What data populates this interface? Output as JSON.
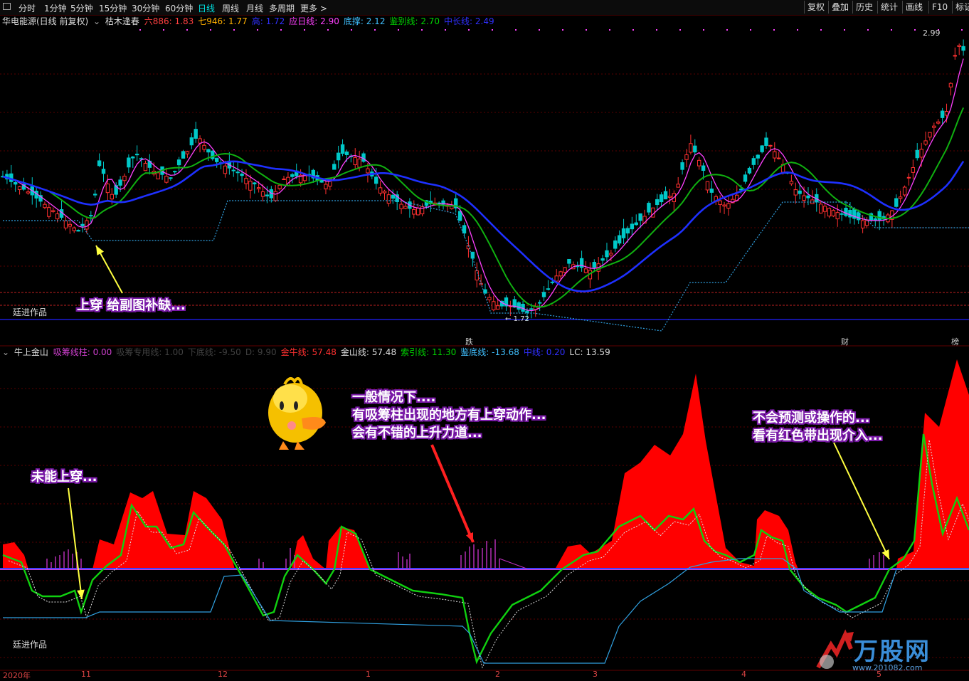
{
  "toolbar": {
    "left_items": [
      "分时",
      "1分钟",
      "5分钟",
      "15分钟",
      "30分钟",
      "60分钟",
      "日线",
      "周线",
      "月线",
      "多周期",
      "更多 >"
    ],
    "active_item": "日线",
    "right_items": [
      "复权",
      "叠加",
      "历史",
      "统计",
      "画线",
      "F10",
      "标记"
    ]
  },
  "main_header": {
    "stock": "华电能源(日线 前复权)",
    "indicator": "枯木逢春",
    "values": [
      {
        "label": "六886: ",
        "value": "1.83",
        "color": "#ff4040"
      },
      {
        "label": "七946: ",
        "value": "1.77",
        "color": "#ffb000"
      },
      {
        "label": "高: ",
        "value": "1.72",
        "color": "#3030ff"
      },
      {
        "label": "应日线: ",
        "value": "2.90",
        "color": "#ff40ff"
      },
      {
        "label": "底撑: ",
        "value": "2.12",
        "color": "#40c0ff"
      },
      {
        "label": "鉴别线: ",
        "value": "2.70",
        "color": "#00d000"
      },
      {
        "label": "中长线: ",
        "value": "2.49",
        "color": "#3030ff"
      }
    ],
    "price_high": "2.99",
    "price_low": "1.72",
    "author": "廷进作品"
  },
  "sub_header": {
    "indicator": "牛上金山",
    "values": [
      {
        "label": "吸筹线柱: ",
        "value": "0.00",
        "color": "#d040d0"
      },
      {
        "label": "吸筹专用线: ",
        "value": "1.00",
        "color": "#404040"
      },
      {
        "label": "下底线: ",
        "value": "-9.50",
        "color": "#404040"
      },
      {
        "label": "D: ",
        "value": "9.90",
        "color": "#404040"
      },
      {
        "label": "金牛线: ",
        "value": "57.48",
        "color": "#ff3030"
      },
      {
        "label": "金山线: ",
        "value": "57.48",
        "color": "#dddddd"
      },
      {
        "label": "索引线: ",
        "value": "11.30",
        "color": "#00d000"
      },
      {
        "label": "鉴底线: ",
        "value": "-13.68",
        "color": "#40c0ff"
      },
      {
        "label": "中线: ",
        "value": "0.20",
        "color": "#3030ff"
      },
      {
        "label": "LC: ",
        "value": "13.59",
        "color": "#dddddd"
      }
    ],
    "author": "廷进作品"
  },
  "markers": [
    {
      "text": "跌",
      "color": "#00d000"
    },
    {
      "text": "财",
      "color": "#4090ff"
    },
    {
      "text": "榜",
      "color": "#ffb000"
    }
  ],
  "annotations": {
    "main_cross": "上穿 给副图补缺...",
    "fail_cross": "未能上穿...",
    "general_1": "一般情况下....",
    "general_2": "有吸筹柱出现的地方有上穿动作...",
    "general_3": "会有不错的上升力道...",
    "no_predict_1": "不会预测或操作的...",
    "no_predict_2": "看有红色带出现介入..."
  },
  "x_axis": {
    "labels": [
      "2020年",
      "11",
      "12",
      "1",
      "2",
      "3",
      "4",
      "5"
    ]
  },
  "watermark": {
    "name": "万股网",
    "url": "www.201082.com"
  },
  "colors": {
    "up": "#ff3030",
    "down": "#00c8c8",
    "ma_fast": "#ff40ff",
    "ma_mid": "#10b010",
    "ma_slow": "#1e30ff",
    "support": "#30a0e0",
    "red_fill": "#ff0000",
    "accumulation": "#c030c0",
    "annotation_bg": "#7a1aa8"
  },
  "icons": [
    "window-icon",
    "chevron-down-icon",
    "duck-mascot-icon",
    "arrow-icon",
    "watermark-logo-icon"
  ]
}
